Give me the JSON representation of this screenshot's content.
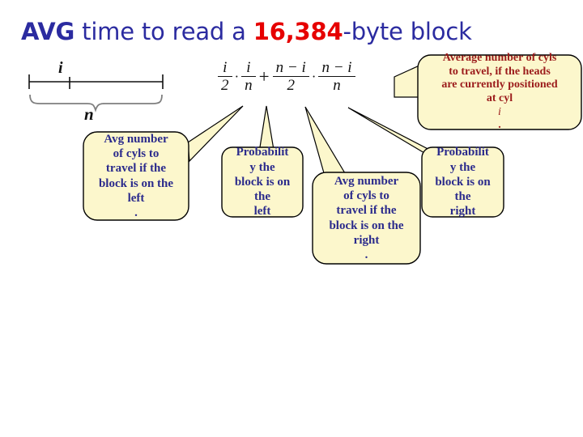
{
  "slide": {
    "title": {
      "avg": "AVG",
      "mid": " time to read a ",
      "number": "16,384",
      "tail": "-byte block"
    },
    "title_colors": {
      "text": "#2B2BA0",
      "number": "#E60000"
    },
    "theme": {
      "callout_fill": "#FCF7CC",
      "callout_border": "#000000",
      "blue_text": "#2B2B8C",
      "red_text": "#9B1B1B",
      "brace_gray": "#7F7F7F",
      "background": "#FFFFFF"
    }
  },
  "diagram": {
    "axis_label": "i",
    "brace_label": "n",
    "tick_count": 3
  },
  "formula": {
    "terms": [
      {
        "num": "i",
        "den": "2"
      },
      {
        "num": "i",
        "den": "n"
      },
      {
        "num": "n − i",
        "den": "2"
      },
      {
        "num": "n − i",
        "den": "n"
      }
    ],
    "operators": {
      "dot": "·",
      "plus": "+"
    },
    "plain": "i/2 · i/n + (n−i)/2 · (n−i)/n"
  },
  "callouts": {
    "avg_left": {
      "lines": [
        "Avg number",
        "of cyls to",
        "travel if the",
        "block is on the"
      ],
      "last_bold": "left",
      "last_tail": ".",
      "color": "blue"
    },
    "prob_left": {
      "lines": [
        "Probabilit",
        "y the",
        "block is on"
      ],
      "last_prefix": "the ",
      "last_bold": "left",
      "last_tail": "",
      "color": "blue"
    },
    "avg_right": {
      "lines": [
        "Avg number",
        "of cyls to",
        "travel if the",
        "block is on the"
      ],
      "last_bold": "right",
      "last_tail": ".",
      "color": "blue"
    },
    "prob_right": {
      "lines": [
        "Probabilit",
        "y the",
        "block is on"
      ],
      "last_prefix": "the ",
      "last_bold": "right",
      "last_tail": "",
      "color": "blue"
    },
    "average_heads": {
      "lines": [
        "Average number of cyls",
        "to travel, if the heads",
        "are currently positioned"
      ],
      "last_prefix": "at cyl ",
      "last_italic": "i",
      "last_tail": ".",
      "color": "red"
    }
  }
}
